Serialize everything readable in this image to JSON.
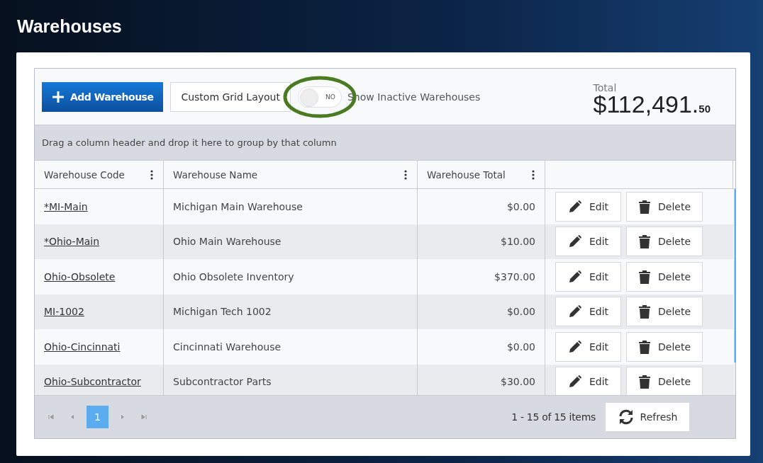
{
  "page_title": "Warehouses",
  "toolbar": {
    "add_button": "Add Warehouse",
    "layout_button": "Custom Grid Layout",
    "toggle": {
      "on": false,
      "state_text": "NO",
      "highlighted": true
    },
    "toggle_label": "Show Inactive Warehouses",
    "total_label": "Total",
    "total_main": "$112,491.",
    "total_cents": "50"
  },
  "group_hint": "Drag a column header and drop it here to group by that column",
  "columns": [
    "Warehouse Code",
    "Warehouse Name",
    "Warehouse Total"
  ],
  "rows": [
    {
      "code": "*MI-Main",
      "name": "Michigan Main Warehouse",
      "total": "$0.00",
      "edit": "Edit",
      "delete": "Delete"
    },
    {
      "code": "*Ohio-Main",
      "name": "Ohio Main Warehouse",
      "total": "$10.00",
      "edit": "Edit",
      "delete": "Delete"
    },
    {
      "code": "Ohio-Obsolete",
      "name": "Ohio Obsolete Inventory",
      "total": "$370.00",
      "edit": "Edit",
      "delete": "Delete"
    },
    {
      "code": "MI-1002",
      "name": "Michigan Tech 1002",
      "total": "$0.00",
      "edit": "Edit",
      "delete": "Delete"
    },
    {
      "code": "Ohio-Cincinnati",
      "name": "Cincinnati Warehouse",
      "total": "$0.00",
      "edit": "Edit",
      "delete": "Delete"
    },
    {
      "code": "Ohio-Subcontractor",
      "name": "Subcontractor Parts",
      "total": "$30.00",
      "edit": "Edit",
      "delete": "Delete"
    }
  ],
  "pager": {
    "pages": [
      {
        "label": "1",
        "selected": true
      }
    ],
    "summary": "1 - 15 of 15 items",
    "refresh": "Refresh"
  }
}
